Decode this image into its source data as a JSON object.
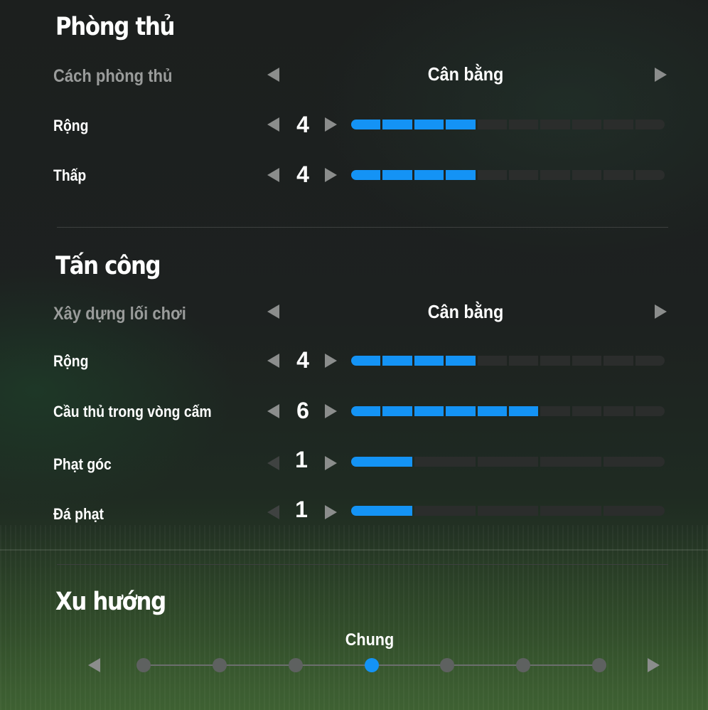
{
  "defense": {
    "title": "Phòng thủ",
    "style": {
      "label": "Cách phòng thủ",
      "value": "Cân bằng"
    },
    "sliders": [
      {
        "label": "Rộng",
        "value": 4,
        "max": 10
      },
      {
        "label": "Thấp",
        "value": 4,
        "max": 10
      }
    ]
  },
  "attack": {
    "title": "Tấn công",
    "style": {
      "label": "Xây dựng lối chơi",
      "value": "Cân bằng"
    },
    "sliders": [
      {
        "label": "Rộng",
        "value": 4,
        "max": 10
      },
      {
        "label": "Cầu thủ trong vòng cấm",
        "value": 6,
        "max": 10
      },
      {
        "label": "Phạt góc",
        "value": 1,
        "max": 5
      },
      {
        "label": "Đá phạt",
        "value": 1,
        "max": 5
      }
    ]
  },
  "tendency": {
    "title": "Xu hướng",
    "value": "Chung",
    "steps": 7,
    "selected_index": 3
  },
  "colors": {
    "accent": "#1493f5",
    "segment_off": "#2b2d2c"
  }
}
